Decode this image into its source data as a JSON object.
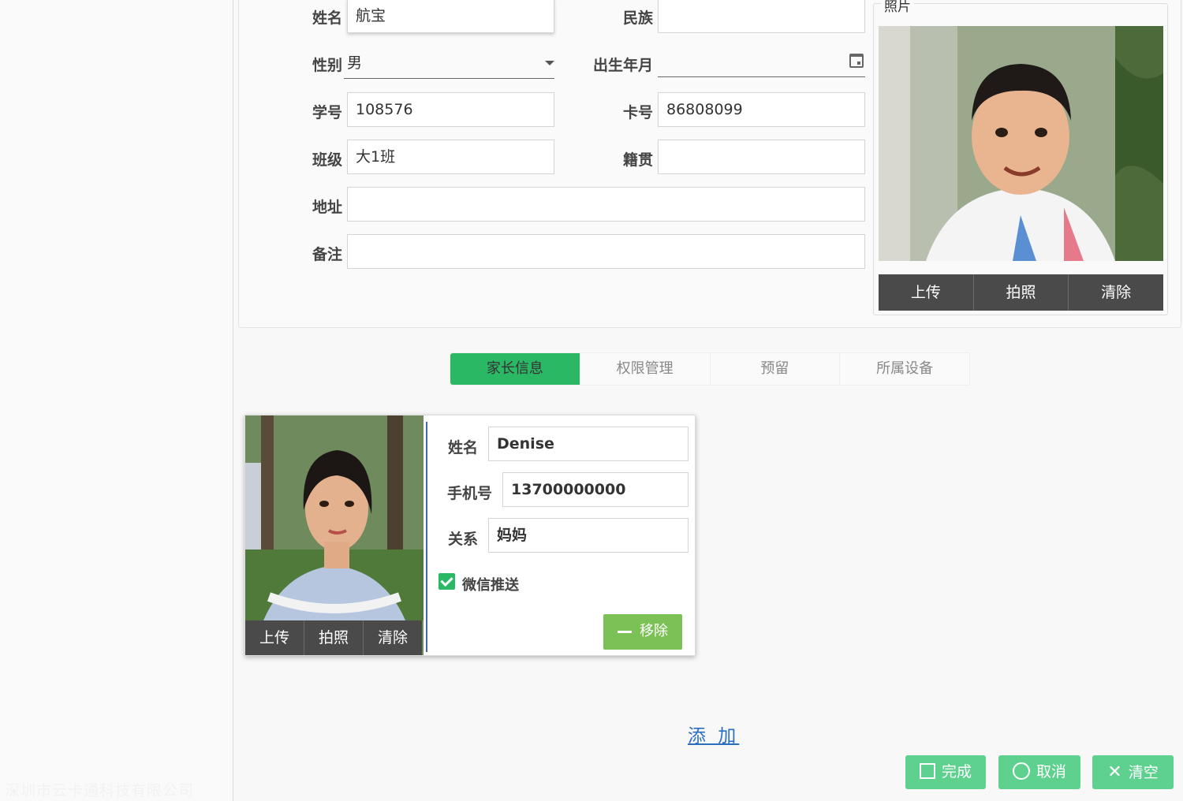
{
  "watermark": "深圳市云卡通科技有限公司",
  "student": {
    "name_label": "姓名",
    "name_value": "航宝",
    "ethnicity_label": "民族",
    "ethnicity_value": "",
    "gender_label": "性别",
    "gender_value": "男",
    "birth_label": "出生年月",
    "birth_value": "",
    "student_no_label": "学号",
    "student_no_value": "108576",
    "card_no_label": "卡号",
    "card_no_value": "86808099",
    "class_label": "班级",
    "class_value": "大1班",
    "native_label": "籍贯",
    "native_value": "",
    "address_label": "地址",
    "address_value": "",
    "remark_label": "备注",
    "remark_value": ""
  },
  "photo": {
    "legend": "照片",
    "buttons": [
      "上传",
      "拍照",
      "清除"
    ]
  },
  "tabs": [
    "家长信息",
    "权限管理",
    "预留",
    "所属设备"
  ],
  "parent": {
    "name_label": "姓名",
    "name_value": "Denise",
    "phone_label": "手机号",
    "phone_value": "13700000000",
    "relation_label": "关系",
    "relation_value": "妈妈",
    "wechat_label": "微信推送",
    "remove_label": "移除",
    "photo_buttons": [
      "上传",
      "拍照",
      "清除"
    ]
  },
  "add_label": "添 加",
  "footer": {
    "done_label": "完成",
    "cancel_label": "取消",
    "clear_label": "清空"
  },
  "colors": {
    "accent": "#2bb865",
    "footer_button": "#5ed18f",
    "remove_button": "#7cc156",
    "link": "#2a6fbf"
  }
}
